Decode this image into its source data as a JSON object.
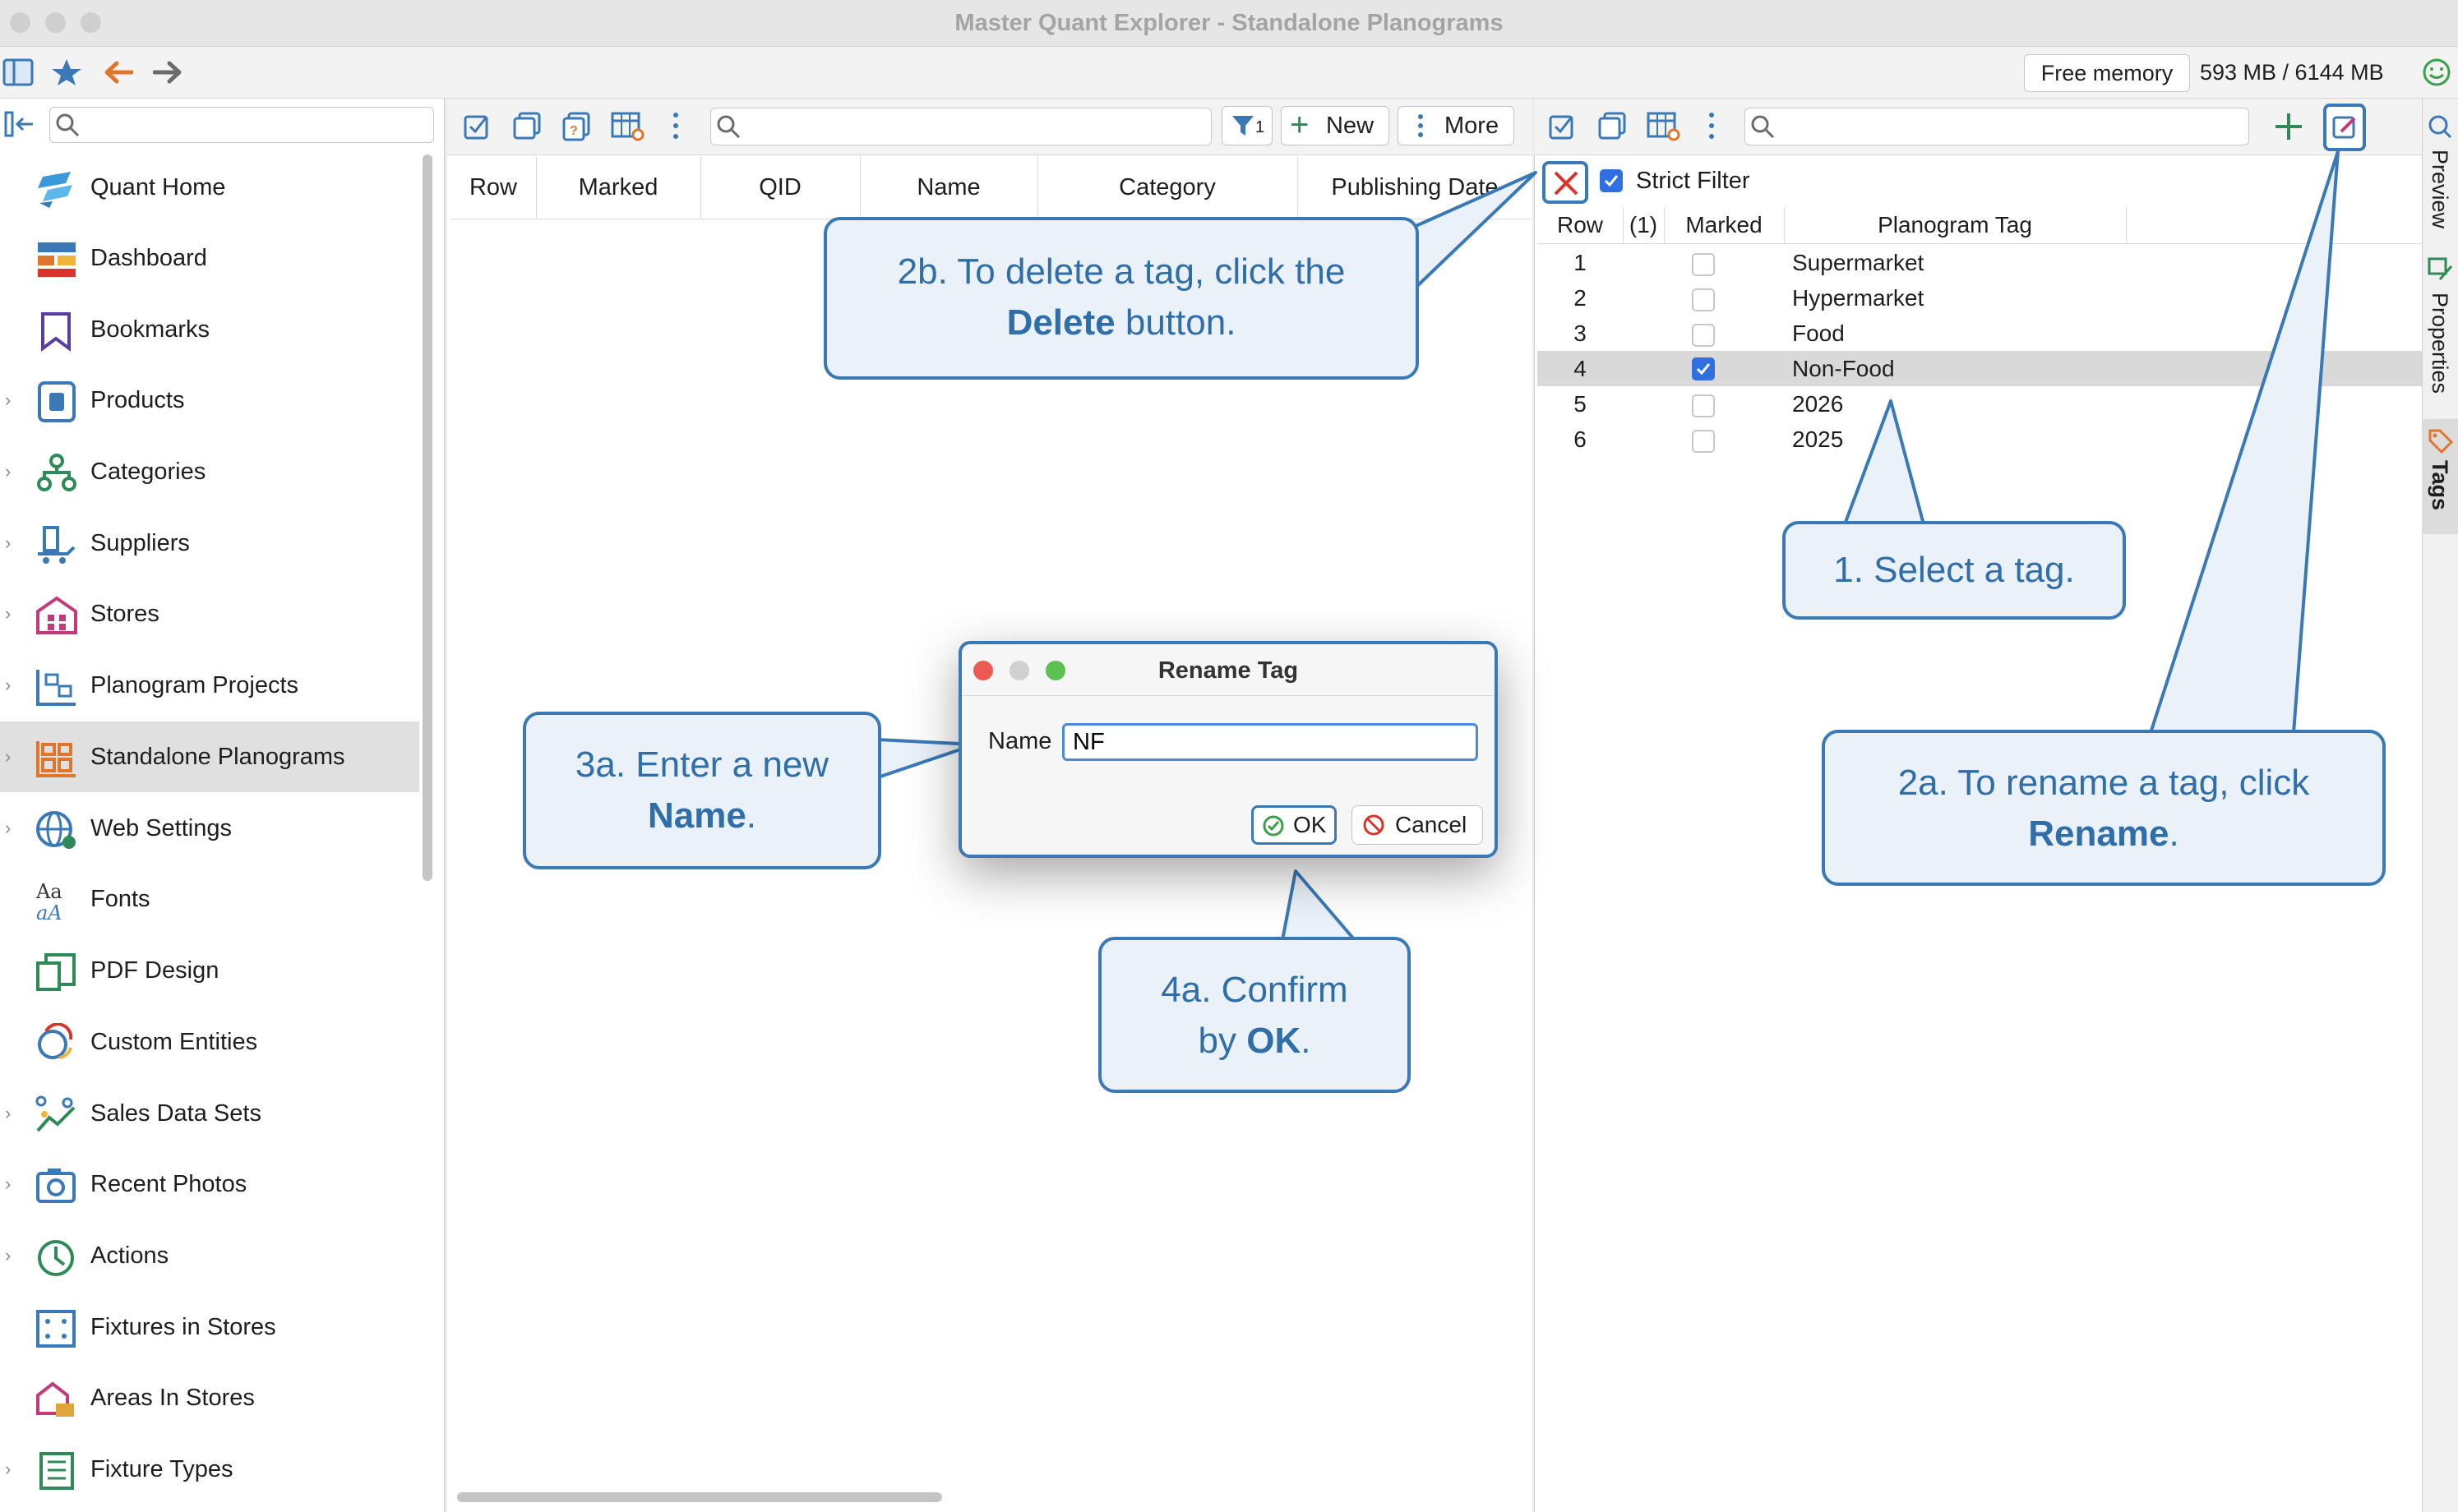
{
  "window": {
    "title": "Master Quant Explorer - Standalone Planograms"
  },
  "toolbar": {
    "memory_label": "Free memory",
    "memory_value": "593 MB / 6144 MB"
  },
  "sidebar": {
    "items": [
      {
        "label": "Quant Home",
        "icon": "quant-home-icon",
        "expandable": false
      },
      {
        "label": "Dashboard",
        "icon": "dashboard-icon",
        "expandable": false
      },
      {
        "label": "Bookmarks",
        "icon": "bookmark-icon",
        "expandable": false
      },
      {
        "label": "Products",
        "icon": "products-icon",
        "expandable": true
      },
      {
        "label": "Categories",
        "icon": "categories-icon",
        "expandable": true
      },
      {
        "label": "Suppliers",
        "icon": "suppliers-icon",
        "expandable": true
      },
      {
        "label": "Stores",
        "icon": "stores-icon",
        "expandable": true
      },
      {
        "label": "Planogram Projects",
        "icon": "planogram-projects-icon",
        "expandable": true
      },
      {
        "label": "Standalone Planograms",
        "icon": "standalone-planograms-icon",
        "expandable": true,
        "selected": true
      },
      {
        "label": "Web Settings",
        "icon": "web-settings-icon",
        "expandable": true
      },
      {
        "label": "Fonts",
        "icon": "fonts-icon",
        "expandable": false
      },
      {
        "label": "PDF Design",
        "icon": "pdf-design-icon",
        "expandable": false
      },
      {
        "label": "Custom Entities",
        "icon": "custom-entities-icon",
        "expandable": false
      },
      {
        "label": "Sales Data Sets",
        "icon": "sales-data-icon",
        "expandable": true
      },
      {
        "label": "Recent Photos",
        "icon": "camera-icon",
        "expandable": true
      },
      {
        "label": "Actions",
        "icon": "actions-icon",
        "expandable": true
      },
      {
        "label": "Fixtures in Stores",
        "icon": "fixtures-icon",
        "expandable": false
      },
      {
        "label": "Areas In Stores",
        "icon": "areas-icon",
        "expandable": false
      },
      {
        "label": "Fixture Types",
        "icon": "fixture-types-icon",
        "expandable": true
      }
    ]
  },
  "main": {
    "new_label": "New",
    "more_label": "More",
    "filter_count": "1",
    "columns": [
      "Row",
      "Marked",
      "QID",
      "Name",
      "Category",
      "Publishing Date"
    ]
  },
  "tags_panel": {
    "strict_filter_label": "Strict Filter",
    "columns": [
      "Row",
      "(1)",
      "Marked",
      "Planogram Tag"
    ],
    "rows": [
      {
        "row": "1",
        "marked": false,
        "tag": "Supermarket"
      },
      {
        "row": "2",
        "marked": false,
        "tag": "Hypermarket"
      },
      {
        "row": "3",
        "marked": false,
        "tag": "Food"
      },
      {
        "row": "4",
        "marked": true,
        "tag": "Non-Food"
      },
      {
        "row": "5",
        "marked": false,
        "tag": "2026"
      },
      {
        "row": "6",
        "marked": false,
        "tag": "2025"
      }
    ]
  },
  "side_tabs": [
    "Preview",
    "Properties",
    "Tags"
  ],
  "dialog": {
    "title": "Rename Tag",
    "name_label": "Name",
    "name_value": "NF",
    "ok_label": "OK",
    "cancel_label": "Cancel"
  },
  "callouts": {
    "c2b": {
      "pre": "2b. To delete a tag, click the",
      "bold": "Delete",
      "post": " button."
    },
    "c1": {
      "text": "1. Select a tag."
    },
    "c2a": {
      "pre": "2a. To rename a tag, click",
      "bold": "Rename",
      "post": "."
    },
    "c3a": {
      "pre": "3a. Enter a new",
      "bold": "Name",
      "post": "."
    },
    "c4a": {
      "pre": "4a. Confirm",
      "mid": "by ",
      "bold": "OK",
      "post": "."
    }
  },
  "colors": {
    "accent": "#3a79b5",
    "callout_fill": "#eaf1f8",
    "checkbox_on": "#2f6fe0",
    "delete_red": "#d9342b",
    "selected_row": "#d9d9d9"
  }
}
